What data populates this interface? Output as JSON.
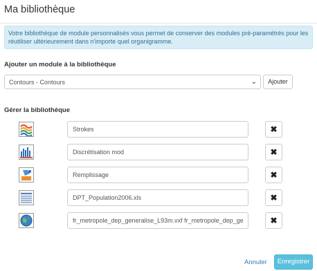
{
  "dialog": {
    "title": "Ma bibliothèque",
    "info": "Votre bibliothèque de module personnalisés vous permet de conserver des modules pré-paramétrés pour les réutiliser ultérieurement dans n'importe quel organigramme."
  },
  "add_section": {
    "label": "Ajouter un module à la bibliothèque",
    "selected": "Contours - Contours",
    "add_label": "Ajouter"
  },
  "manage_section": {
    "label": "Gérer la bibliothèque",
    "modules": [
      {
        "icon": "strokes-icon",
        "name": "Strokes"
      },
      {
        "icon": "bar-chart-icon",
        "name": "Discrétisation mod"
      },
      {
        "icon": "fill-icon",
        "name": "Remplissage"
      },
      {
        "icon": "spreadsheet-icon",
        "name": "DPT_Population2006.xls"
      },
      {
        "icon": "globe-icon",
        "name": "fr_metropole_dep_generalise_L93m.vxf fr_metropole_dep_ge"
      }
    ],
    "delete_symbol": "✖"
  },
  "footer": {
    "cancel_label": "Annuler",
    "save_label": "Enregistrer"
  }
}
